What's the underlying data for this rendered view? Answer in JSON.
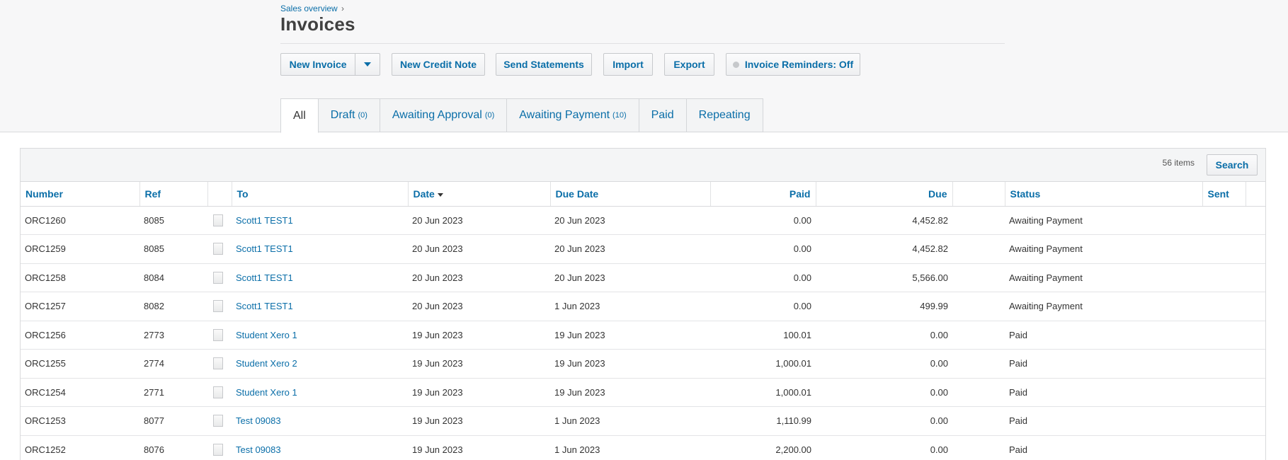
{
  "breadcrumb": {
    "link": "Sales overview",
    "separator": "›"
  },
  "page_title": "Invoices",
  "actions": {
    "new_invoice": "New Invoice",
    "new_credit_note": "New Credit Note",
    "send_statements": "Send Statements",
    "import": "Import",
    "export": "Export",
    "invoice_reminders": "Invoice Reminders: Off"
  },
  "tabs": [
    {
      "label": "All",
      "count": ""
    },
    {
      "label": "Draft",
      "count": "(0)"
    },
    {
      "label": "Awaiting Approval",
      "count": "(0)"
    },
    {
      "label": "Awaiting Payment",
      "count": "(10)"
    },
    {
      "label": "Paid",
      "count": ""
    },
    {
      "label": "Repeating",
      "count": ""
    }
  ],
  "toolbar": {
    "items_count": "56 items",
    "search_label": "Search"
  },
  "table": {
    "headers": {
      "number": "Number",
      "ref": "Ref",
      "to": "To",
      "date": "Date",
      "due_date": "Due Date",
      "paid": "Paid",
      "due": "Due",
      "status": "Status",
      "sent": "Sent"
    },
    "rows": [
      {
        "number": "ORC1260",
        "ref": "8085",
        "to": "Scott1 TEST1",
        "date": "20 Jun 2023",
        "due_date": "20 Jun 2023",
        "paid": "0.00",
        "due": "4,452.82",
        "status": "Awaiting Payment"
      },
      {
        "number": "ORC1259",
        "ref": "8085",
        "to": "Scott1 TEST1",
        "date": "20 Jun 2023",
        "due_date": "20 Jun 2023",
        "paid": "0.00",
        "due": "4,452.82",
        "status": "Awaiting Payment"
      },
      {
        "number": "ORC1258",
        "ref": "8084",
        "to": "Scott1 TEST1",
        "date": "20 Jun 2023",
        "due_date": "20 Jun 2023",
        "paid": "0.00",
        "due": "5,566.00",
        "status": "Awaiting Payment"
      },
      {
        "number": "ORC1257",
        "ref": "8082",
        "to": "Scott1 TEST1",
        "date": "20 Jun 2023",
        "due_date": "1 Jun 2023",
        "paid": "0.00",
        "due": "499.99",
        "status": "Awaiting Payment"
      },
      {
        "number": "ORC1256",
        "ref": "2773",
        "to": "Student Xero 1",
        "date": "19 Jun 2023",
        "due_date": "19 Jun 2023",
        "paid": "100.01",
        "due": "0.00",
        "status": "Paid"
      },
      {
        "number": "ORC1255",
        "ref": "2774",
        "to": "Student Xero 2",
        "date": "19 Jun 2023",
        "due_date": "19 Jun 2023",
        "paid": "1,000.01",
        "due": "0.00",
        "status": "Paid"
      },
      {
        "number": "ORC1254",
        "ref": "2771",
        "to": "Student Xero 1",
        "date": "19 Jun 2023",
        "due_date": "19 Jun 2023",
        "paid": "1,000.01",
        "due": "0.00",
        "status": "Paid"
      },
      {
        "number": "ORC1253",
        "ref": "8077",
        "to": "Test 09083",
        "date": "19 Jun 2023",
        "due_date": "1 Jun 2023",
        "paid": "1,110.99",
        "due": "0.00",
        "status": "Paid"
      },
      {
        "number": "ORC1252",
        "ref": "8076",
        "to": "Test 09083",
        "date": "19 Jun 2023",
        "due_date": "1 Jun 2023",
        "paid": "2,200.00",
        "due": "0.00",
        "status": "Paid"
      }
    ]
  },
  "colors": {
    "link": "#0a6ea8",
    "header_bg": "#f7f7f8",
    "text": "#333333"
  }
}
